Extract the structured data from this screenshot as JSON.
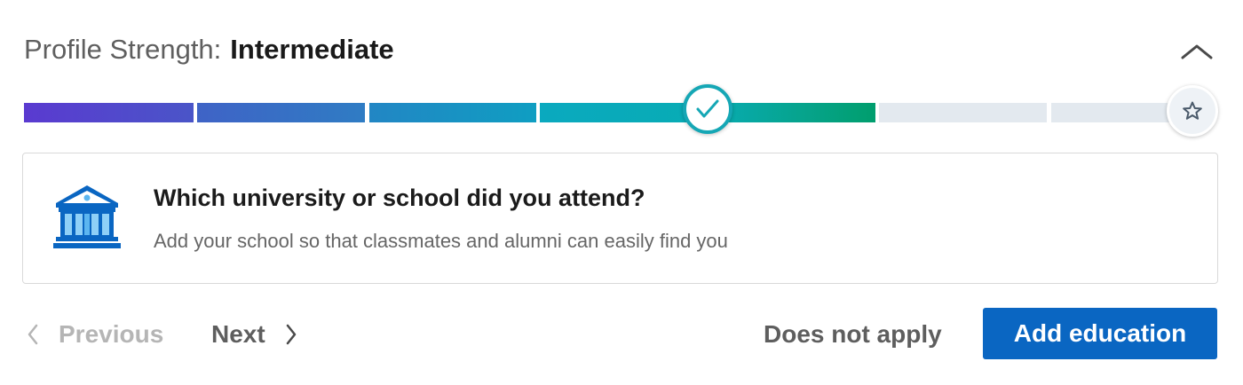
{
  "header": {
    "label": "Profile Strength:",
    "level": "Intermediate",
    "collapse_icon": "chevron-up-icon"
  },
  "progress": {
    "total_segments": 6,
    "filled_segments": 4,
    "current_marker_icon": "checkmark-icon",
    "goal_marker_icon": "star-icon",
    "colors": {
      "start": "#5a3ad0",
      "middle": "#0aa9bf",
      "end": "#009e6d",
      "empty": "#e3e9ef",
      "marker_border": "#15a7b5"
    }
  },
  "card": {
    "icon": "university-building-icon",
    "title": "Which university or school did you attend?",
    "subtitle": "Add your school so that classmates and alumni can easily find you"
  },
  "footer": {
    "previous_label": "Previous",
    "next_label": "Next",
    "does_not_apply_label": "Does not apply",
    "primary_label": "Add education",
    "primary_color": "#0a66c2"
  }
}
